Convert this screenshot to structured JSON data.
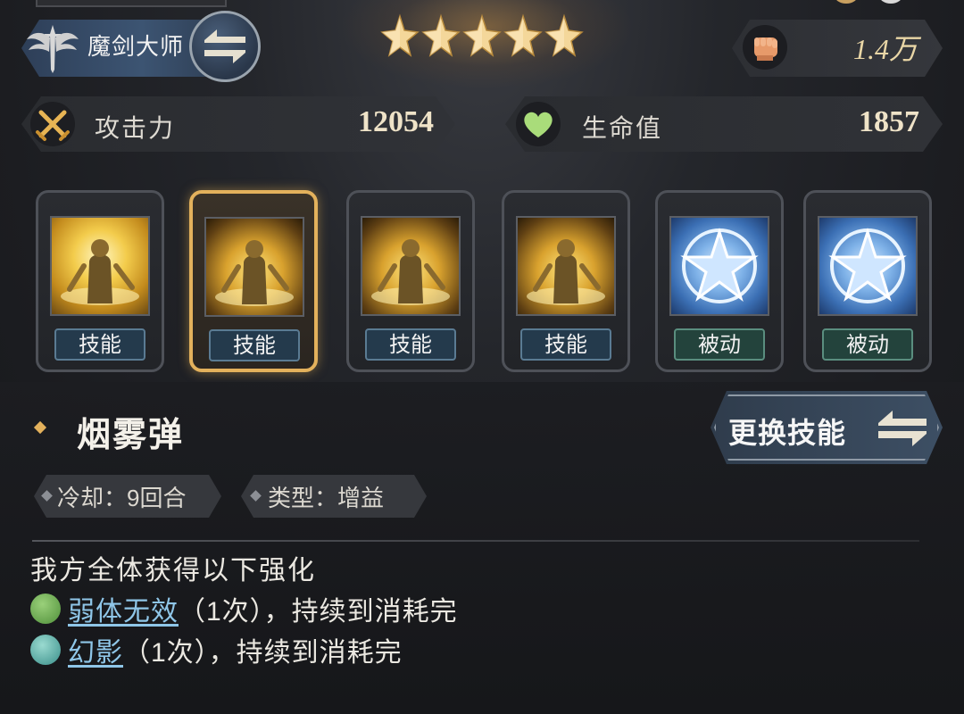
{
  "hero": {
    "class_name": "魔剑大师",
    "stars": 5,
    "power": "1.4万"
  },
  "stats": [
    {
      "label": "攻击力",
      "value": "12054",
      "icon": "crossed-swords-icon"
    },
    {
      "label": "生命值",
      "value": "1857",
      "icon": "heart-icon"
    }
  ],
  "skills": [
    {
      "tag": "技能",
      "kind": "skill",
      "art": "golden-warrior",
      "selected": false
    },
    {
      "tag": "技能",
      "kind": "skill",
      "art": "golden-aura-knight",
      "selected": true
    },
    {
      "tag": "技能",
      "kind": "skill",
      "art": "golden-aura-knight",
      "selected": false
    },
    {
      "tag": "技能",
      "kind": "skill",
      "art": "golden-aura-knight",
      "selected": false
    },
    {
      "tag": "被动",
      "kind": "passive",
      "art": "blue-star",
      "selected": false
    },
    {
      "tag": "被动",
      "kind": "passive",
      "art": "blue-star",
      "selected": false
    }
  ],
  "detail": {
    "skill_name": "烟雾弹",
    "change_button": "更换技能",
    "cooldown": "冷却：9回合",
    "type": "类型：增益",
    "description_head": "我方全体获得以下强化",
    "effects": [
      {
        "name": "弱体无效",
        "suffix": "（1次），持续到消耗完",
        "icon_color": "#5fa84a"
      },
      {
        "name": "幻影",
        "suffix": "（1次），持续到消耗完",
        "icon_color": "#4aa0a8"
      }
    ]
  },
  "colors": {
    "accent_gold": "#e3b15c",
    "link_blue": "#8fc6e8",
    "skill_tag": "#243a4c",
    "passive_tag": "#23433c"
  }
}
